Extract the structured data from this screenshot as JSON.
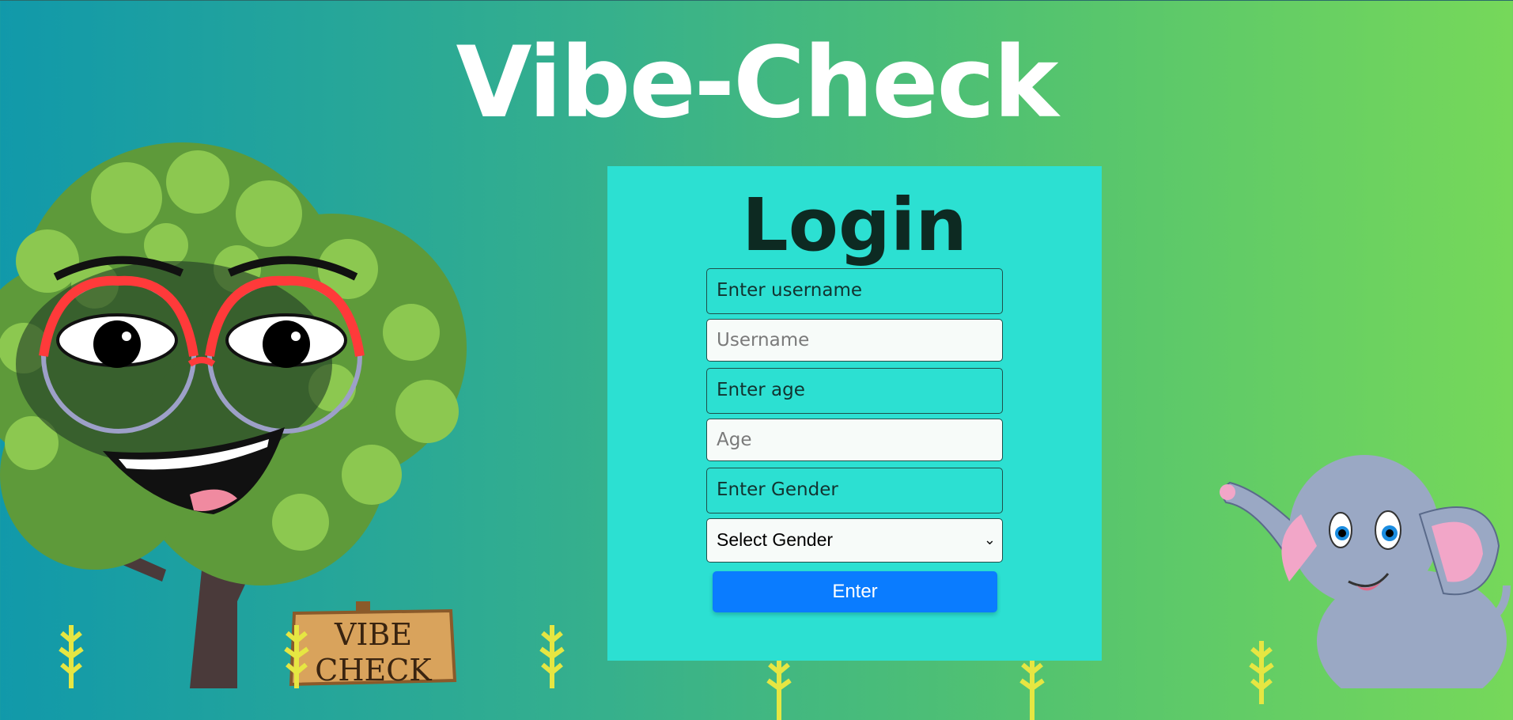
{
  "app": {
    "title": "Vibe-Check"
  },
  "login": {
    "heading": "Login",
    "username_label": "Enter username",
    "username_placeholder": "Username",
    "age_label": "Enter age",
    "age_placeholder": "Age",
    "gender_label": "Enter Gender",
    "gender_select_value": "Select Gender",
    "enter_label": "Enter"
  },
  "decor": {
    "sign_line1": "VIBE",
    "sign_line2": "CHECK"
  },
  "colors": {
    "card": "#2ce0d2",
    "button": "#0a7cff",
    "title": "#ffffff"
  }
}
